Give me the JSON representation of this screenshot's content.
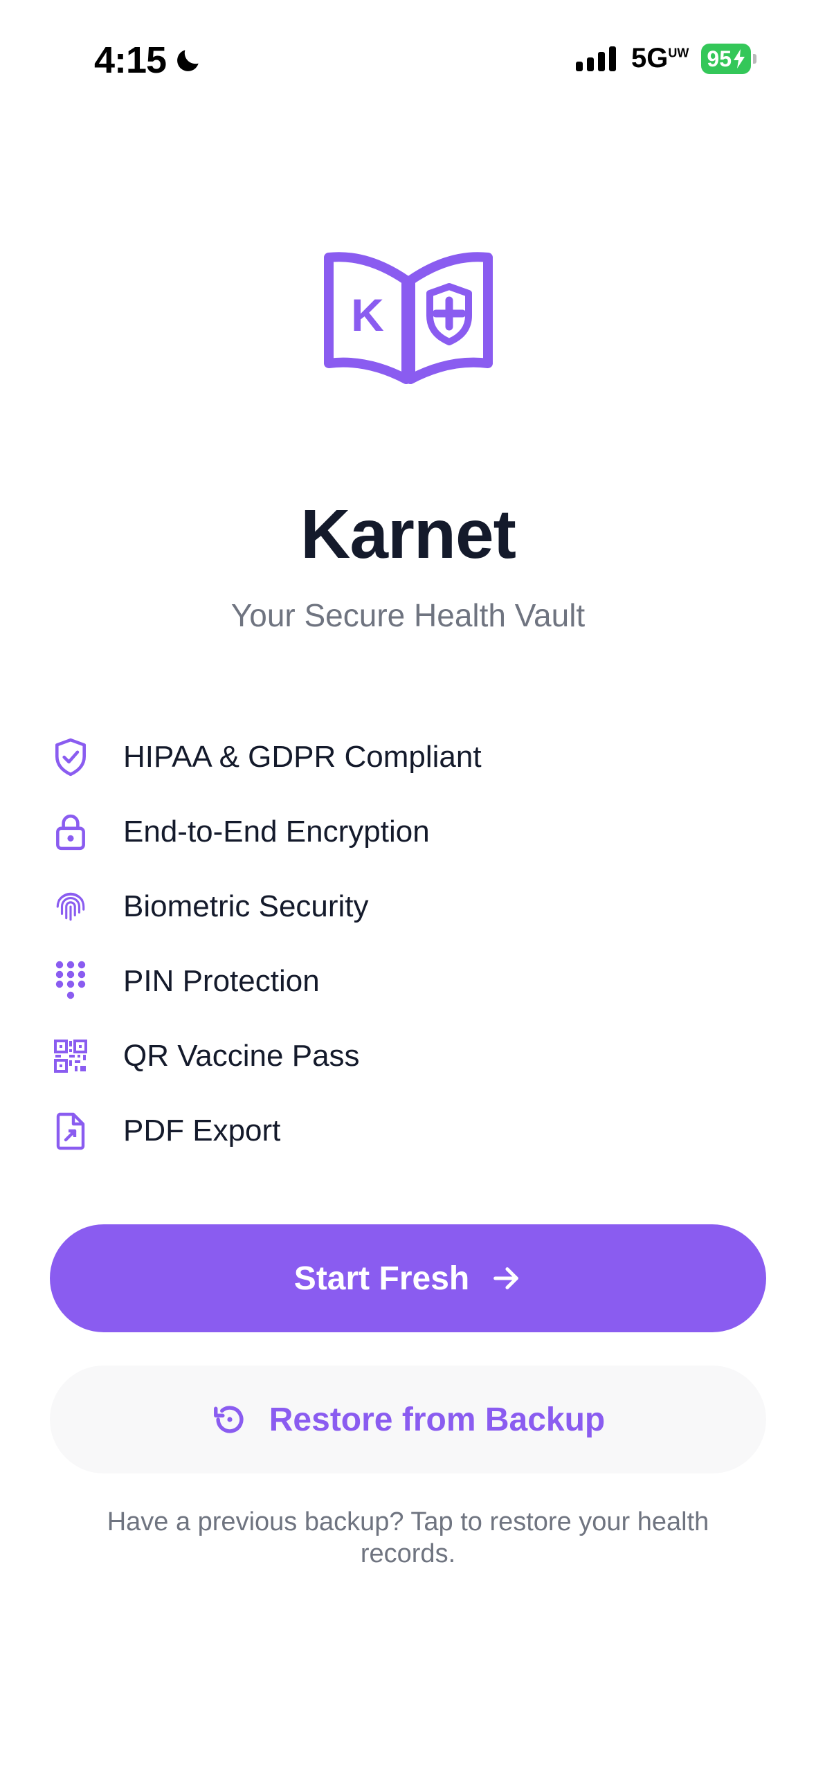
{
  "status_bar": {
    "time": "4:15",
    "network": "5G",
    "network_suffix": "UW",
    "battery": "95"
  },
  "colors": {
    "accent": "#8a5cf0",
    "title": "#141a2b",
    "muted": "#6f7480",
    "battery": "#34c759"
  },
  "app": {
    "title": "Karnet",
    "subtitle": "Your Secure Health Vault",
    "logo_letter": "K"
  },
  "features": [
    {
      "icon": "shield-check-icon",
      "label": "HIPAA & GDPR Compliant"
    },
    {
      "icon": "lock-icon",
      "label": "End-to-End Encryption"
    },
    {
      "icon": "fingerprint-icon",
      "label": "Biometric Security"
    },
    {
      "icon": "keypad-icon",
      "label": "PIN Protection"
    },
    {
      "icon": "qr-code-icon",
      "label": "QR Vaccine Pass"
    },
    {
      "icon": "file-export-icon",
      "label": "PDF Export"
    }
  ],
  "actions": {
    "start_fresh": "Start Fresh",
    "restore": "Restore from Backup",
    "helper": "Have a previous backup? Tap to restore your health records."
  }
}
